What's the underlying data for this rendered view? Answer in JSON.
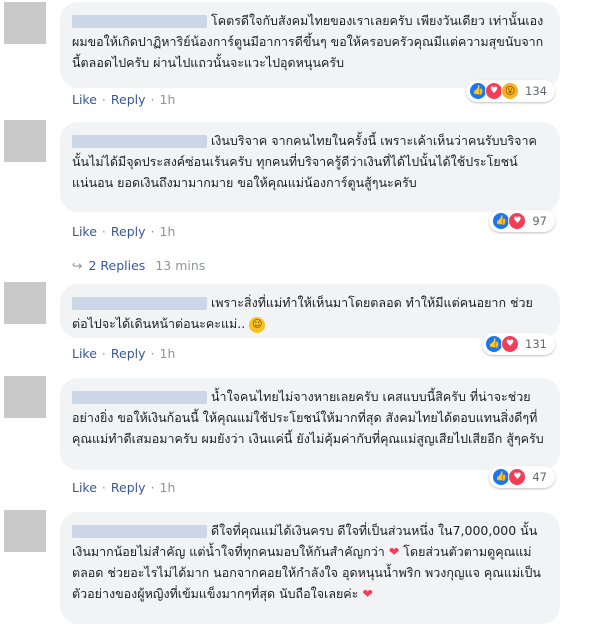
{
  "comments": [
    {
      "text": "โคตรดีใจกับสังคมไทยของเราเลยครับ เพียงวันเดียว เท่านั้นเอง ผมขอให้เกิดปาฏิหาริย์น้องการ์ตูนมีอาการดีขึ้นๆ ขอให้ครอบครัวคุณมีแต่ความสุขนับจากนี้ตลอดไปครับ ผ่านไปแถวนั้นจะแวะไปอุดหนุนครับ",
      "like": "Like",
      "reply": "Reply",
      "time": "1h",
      "reaction_count": "134",
      "reactions": [
        "like",
        "love",
        "wow"
      ]
    },
    {
      "text": "เงินบริจาค จากคนไทยในครั้งนี้ เพราะเค้าเห็นว่าคนรับบริจาคนั้นไม่ได้มีจุดประสงค์ซ่อนเร้นครับ ทุกคนที่บริจาครู้ดีว่าเงินที่ได้ไปนั้นได้ใช้ประโยชน์แน่นอน ยอดเงินถึงมามากมาย ขอให้คุณแม่น้องการ์ตูนสู้ๆนะครับ",
      "like": "Like",
      "reply": "Reply",
      "time": "1h",
      "reaction_count": "97",
      "reactions": [
        "like",
        "love"
      ]
    },
    {
      "text": "เพราะสิ่งที่แม่ทำให้เห็นมาโดยตลอด ทำให้มีแต่คนอยาก ช่วย ต่อไปจะได้เดินหน้าต่อนะคะแม่..",
      "like": "Like",
      "reply": "Reply",
      "time": "1h",
      "reaction_count": "131",
      "reactions": [
        "like",
        "love"
      ]
    },
    {
      "text": "น้ำใจคนไทยไม่จางหายเลยครับ เคสแบบนี้สิครับ ที่น่าจะช่วยอย่างยิ่ง ขอให้เงินก้อนนี้ ให้คุณแม่ใช้ประโยชน์ให้มากที่สุด สังคมไทยได้ตอบแทนสิ่งดีๆที่คุณแม่ทำดีเสมอมาครับ ผมยังว่า เงินแค่นี้ ยังไม่คุ้มค่ากับที่คุณแม่สูญเสียไปเสียอีก สู้ๆครับ",
      "like": "Like",
      "reply": "Reply",
      "time": "1h",
      "reaction_count": "47",
      "reactions": [
        "like",
        "love"
      ]
    },
    {
      "text1": "ดีใจที่คุณแม่ได้เงินครบ ดีใจที่เป็นส่วนหนึ่ง ใน7,000,000 นั้น เงินมากน้อยไม่สำคัญ แต่น้ำใจที่ทุกคนมอบให้กันสำคัญกว่า",
      "text2": "โดยส่วนตัวตามดูคุณแม่ตลอด ช่วยอะไรไม่ได้มาก นอกจากคอยให้กำลังใจ อุดหนุนน้ำพริก พวงกุญแจ คุณแม่เป็นตัวอย่างของผู้หญิงที่เข้มแข็งมากๆที่สุด นับถือใจเลยค่ะ"
    }
  ],
  "replies": {
    "label": "2 Replies",
    "time": "13 mins"
  }
}
